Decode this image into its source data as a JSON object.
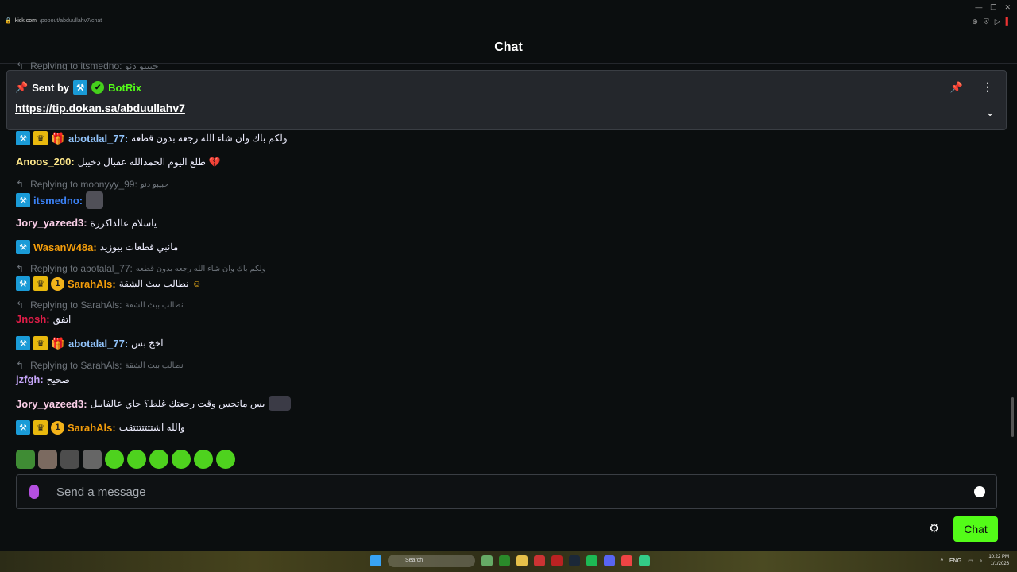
{
  "browser": {
    "url_host": "kick.com",
    "url_path": "/popout/abduullahv7/chat"
  },
  "header": {
    "title": "Chat"
  },
  "cut_reply": "Replying to itsmedno: حبيبو دنو",
  "pinned": {
    "sent_by": "Sent by",
    "bot_name": "BotRix",
    "link": "https://tip.dokan.sa/abduullahv7"
  },
  "messages": [
    {
      "user": "abotalal_77:",
      "text": "ولكم باك وان شاء الله رجعه بدون قطعه"
    },
    {
      "user": "Anoos_200:",
      "text": "طلع اليوم الحمدالله عقبال دخيبل"
    },
    {
      "reply": "Replying to moonyyy_99:",
      "reply_text": "حبيبو دنو",
      "user": "itsmedno:"
    },
    {
      "user": "Jory_yazeed3:",
      "text": "ياسلام عالذاكررة"
    },
    {
      "user": "WasanW48a:",
      "text": "مانبي قطعات بيوزيد"
    },
    {
      "reply": "Replying to abotalal_77:",
      "reply_text": "ولكم باك وان شاء الله رجعه بدون قطعه",
      "user": "SarahAls:",
      "text": "نطالب ببث الشقة"
    },
    {
      "reply": "Replying to SarahAls:",
      "reply_text": "نطالب ببث الشقة",
      "user": "Jnosh:",
      "text": "اتفق"
    },
    {
      "user": "abotalal_77:",
      "text": "اخخ بس"
    },
    {
      "reply": "Replying to SarahAls:",
      "reply_text": "نطالب ببث الشقة",
      "user": "jzfgh:",
      "text": "صحيح"
    },
    {
      "user": "Jory_yazeed3:",
      "text": "بس ماتحس وقت رجعتك غلط؟ جاي عالفاينل"
    },
    {
      "user": "SarahAls:",
      "text": "والله اشتتتتتتتقت"
    }
  ],
  "badges": {
    "sub_tier": "1"
  },
  "input": {
    "placeholder": "Send a message"
  },
  "actions": {
    "chat_button": "Chat"
  },
  "taskbar": {
    "search": "Search",
    "lang": "ENG",
    "time": "10:22 PM",
    "date": "1/1/2026"
  },
  "colors": {
    "accent": "#53fc18",
    "user_abotalal": "#93c5fd",
    "user_anoos": "#fde68a",
    "user_itsmedno": "#3b82f6",
    "user_jory": "#fbcfe8",
    "user_wasan": "#f59e0b",
    "user_sarah": "#f59e0b",
    "user_jnosh": "#e11d48",
    "user_jzfgh": "#c4a4f7"
  }
}
